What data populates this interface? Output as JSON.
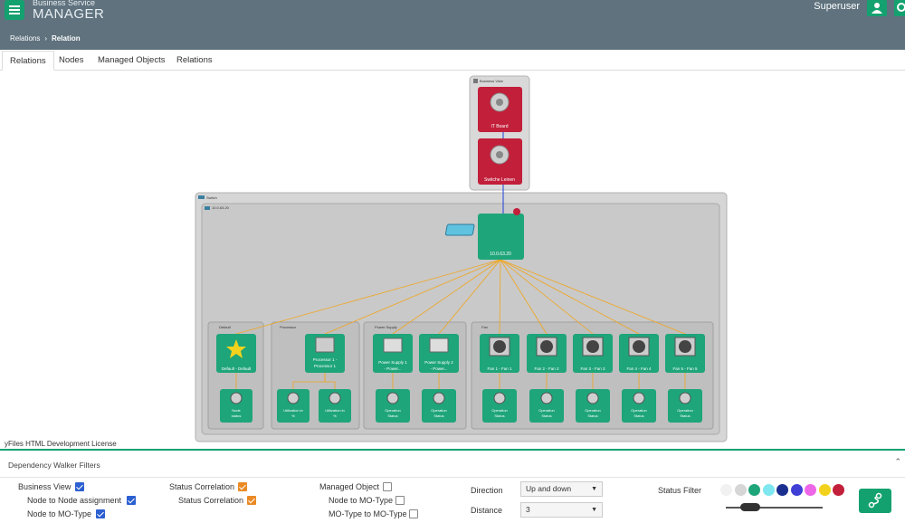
{
  "header": {
    "brand_top": "Business Service",
    "brand_main": "MANAGER",
    "user_name": "Superuser",
    "icons": {
      "menu": "hamburger-menu-icon",
      "user": "user-icon",
      "settings": "gear-icon"
    }
  },
  "breadcrumb": {
    "parent": "Relations",
    "separator": "›",
    "current": "Relation"
  },
  "tabs": [
    {
      "label": "Relations",
      "active": true
    },
    {
      "label": "Nodes",
      "active": false
    },
    {
      "label": "Managed Objects",
      "active": false
    },
    {
      "label": "Relations",
      "active": false
    }
  ],
  "graph": {
    "business_view": {
      "label": "Business View",
      "nodes": [
        {
          "label": "IT Board",
          "icon": "gear-icon"
        },
        {
          "label": "Switche Leinen",
          "icon": "gear-icon"
        }
      ]
    },
    "switch_group": {
      "label": "Switch",
      "host_label": "10.0.63.20",
      "root_node": {
        "label": "10.0.63.20",
        "icon": "network-switch-icon"
      }
    },
    "subgroups": [
      {
        "label": "Default",
        "icon": "star-icon",
        "nodes": [
          {
            "label": "Default - Default",
            "child": "Node status"
          }
        ]
      },
      {
        "label": "Processor",
        "icon": "cpu-icon",
        "nodes": [
          {
            "label": "Processor 1 - Processor 1",
            "children": [
              "Utilization in %",
              "Utilization in %"
            ]
          }
        ]
      },
      {
        "label": "Power Supply",
        "icon": "power-supply-icon",
        "nodes": [
          {
            "label": "Power Supply 1 - Power...",
            "child": "Operation Status"
          },
          {
            "label": "Power Supply 2 - Power...",
            "child": "Operation Status"
          }
        ]
      },
      {
        "label": "Fan",
        "icon": "fan-icon",
        "nodes": [
          {
            "label": "Fan 1 - Fan 1",
            "child": "Operation Status"
          },
          {
            "label": "Fan 2 - Fan 2",
            "child": "Operation Status"
          },
          {
            "label": "Fan 3 - Fan 3",
            "child": "Operation Status"
          },
          {
            "label": "Fan 4 - Fan 4",
            "child": "Operation Status"
          },
          {
            "label": "Fan 5 - Fan 5",
            "child": "Operation Status"
          }
        ]
      }
    ],
    "colors": {
      "ok": "#1ea57a",
      "critical": "#c21f3a",
      "edge": "#f0a51e",
      "edge_bv": "#1d3fdc",
      "group_bg": "#c9c9c9",
      "group_border": "#a9a9a9"
    }
  },
  "license": "yFiles HTML Development License",
  "filters": {
    "title": "Dependency Walker Filters",
    "business_view": {
      "label": "Business View",
      "checked": true
    },
    "node_to_node": {
      "label": "Node to Node assignment",
      "checked": true
    },
    "node_to_motype": {
      "label": "Node to MO-Type",
      "checked": true
    },
    "status_correlation": {
      "label": "Status Correlation",
      "checked": true
    },
    "status_correlation_sub": {
      "label": "Status Correlation",
      "checked": true
    },
    "managed_object": {
      "label": "Managed Object",
      "checked": false
    },
    "node_to_motype_2": {
      "label": "Node to MO-Type",
      "checked": false
    },
    "motype_to_motype": {
      "label": "MO-Type to MO-Type",
      "checked": false
    },
    "direction": {
      "label": "Direction",
      "value": "Up and down"
    },
    "distance": {
      "label": "Distance",
      "value": "3"
    },
    "status_filter": {
      "label": "Status Filter",
      "colors": [
        "#f1f1f1",
        "#d6d6d6",
        "#1ea57a",
        "#7fe7ef",
        "#1a2f8f",
        "#3f3fd6",
        "#ee66e8",
        "#f2d21c",
        "#c21f3a"
      ],
      "level": 0.25
    },
    "walk_icon": "route-icon"
  }
}
